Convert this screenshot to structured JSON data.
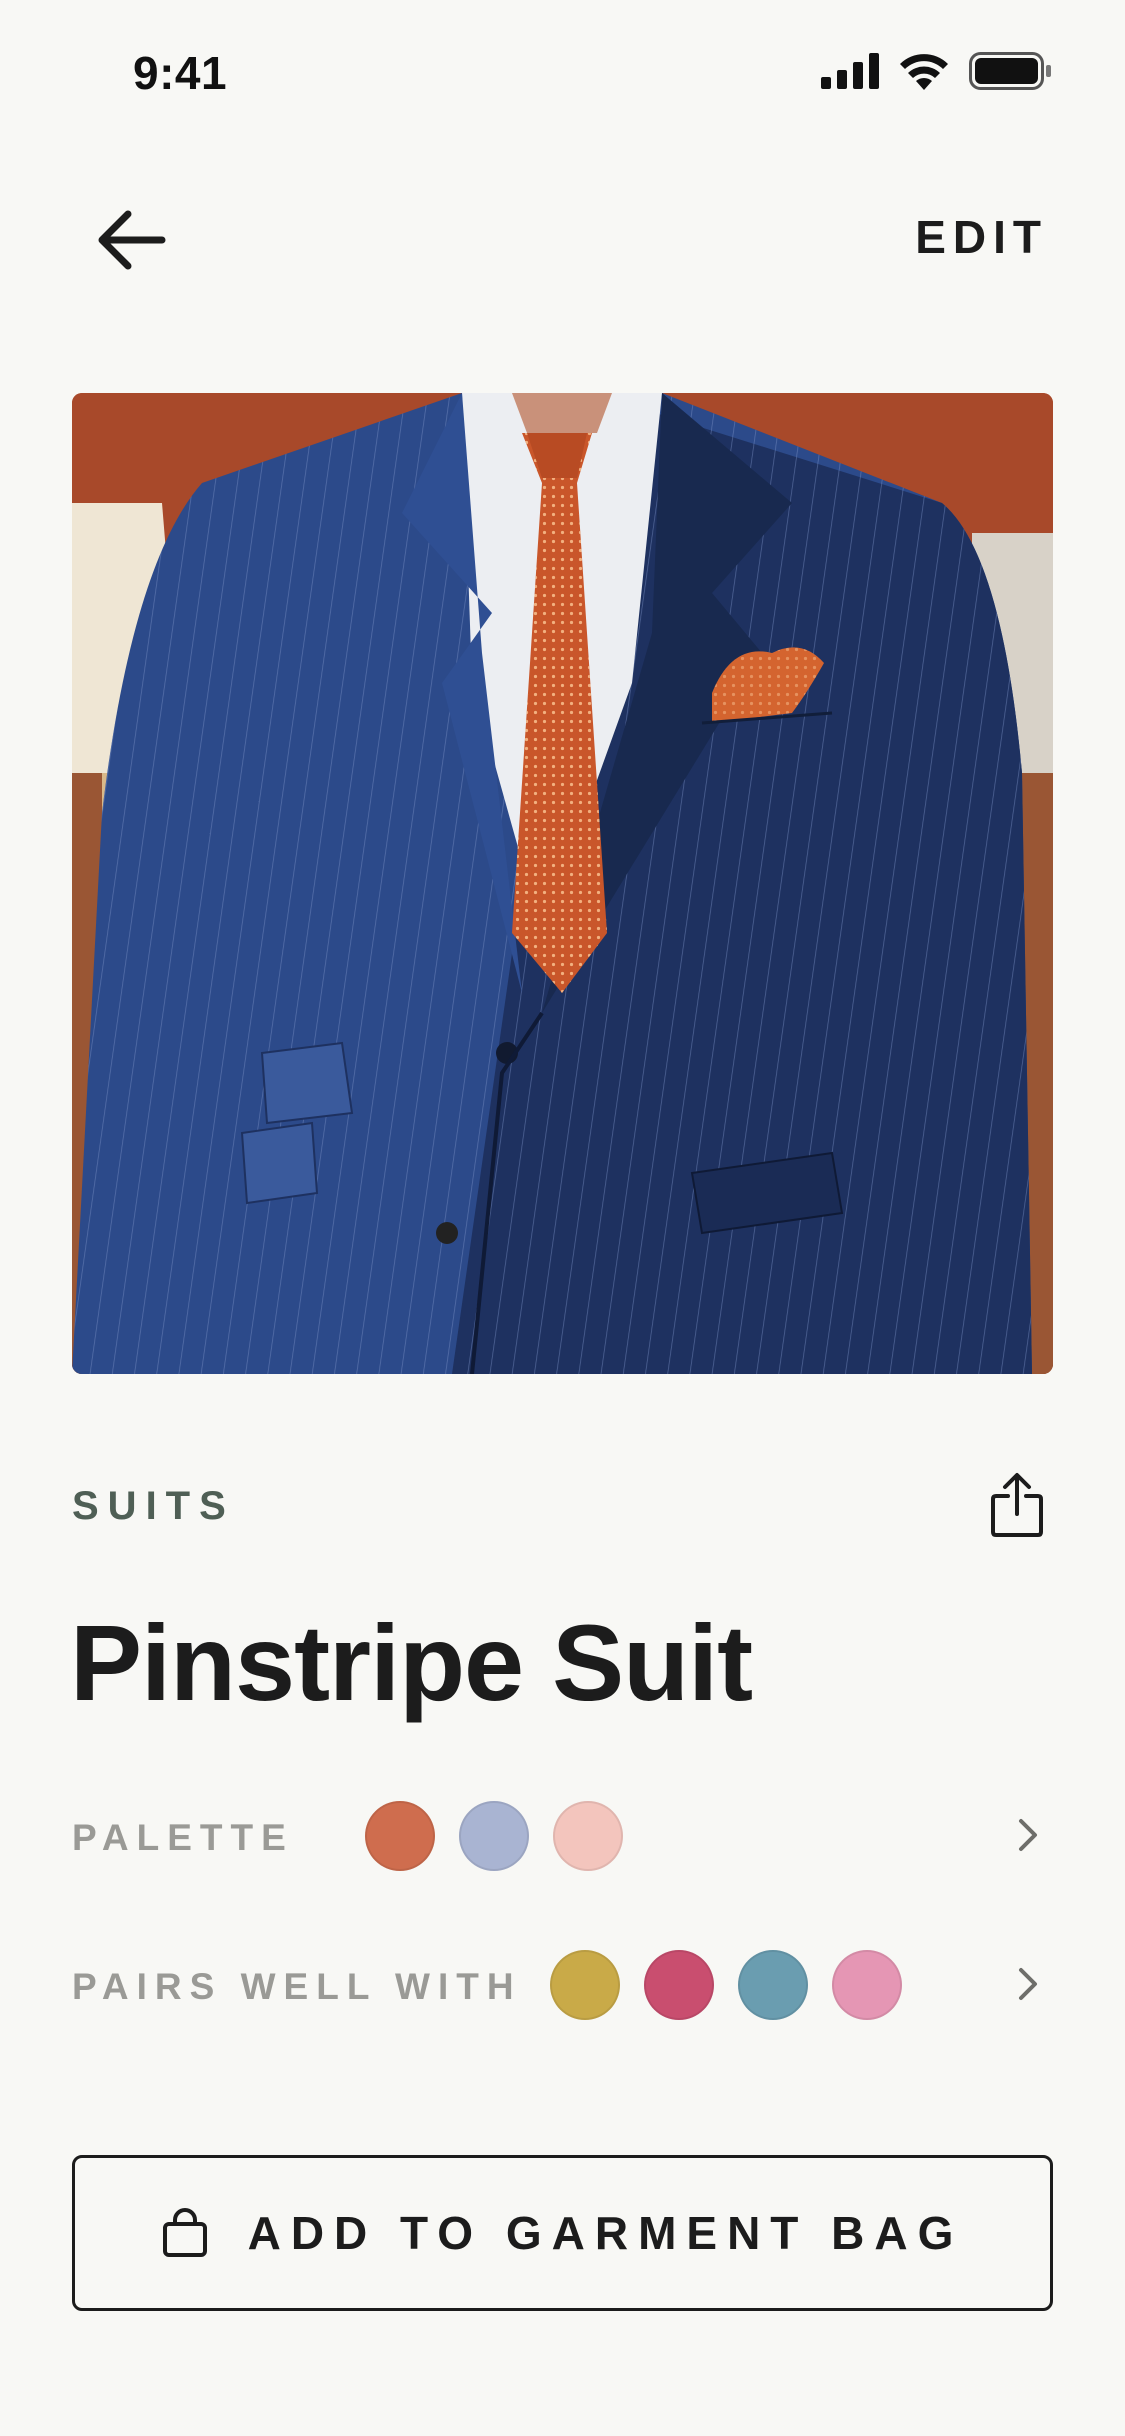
{
  "status_bar": {
    "time": "9:41"
  },
  "nav": {
    "edit_label": "EDIT"
  },
  "product": {
    "category": "SUITS",
    "name": "Pinstripe Suit"
  },
  "palette": {
    "label": "PALETTE",
    "colors": [
      "#cf6d4e",
      "#a9b4d2",
      "#f3c5bd"
    ]
  },
  "pairs_well_with": {
    "label": "PAIRS WELL WITH",
    "colors": [
      "#c9aa48",
      "#c94e6f",
      "#6a9db0",
      "#e596b4"
    ]
  },
  "cta": {
    "label": "ADD TO GARMENT BAG"
  },
  "icons": [
    "back-arrow-icon",
    "share-icon",
    "chevron-right-icon",
    "shopping-bag-icon",
    "signal-icon",
    "wifi-icon",
    "battery-icon"
  ],
  "colors": {
    "background": "#f8f8f5",
    "text": "#1c1c1c",
    "category": "#4f5f55",
    "muted_label": "#9a9a96"
  }
}
